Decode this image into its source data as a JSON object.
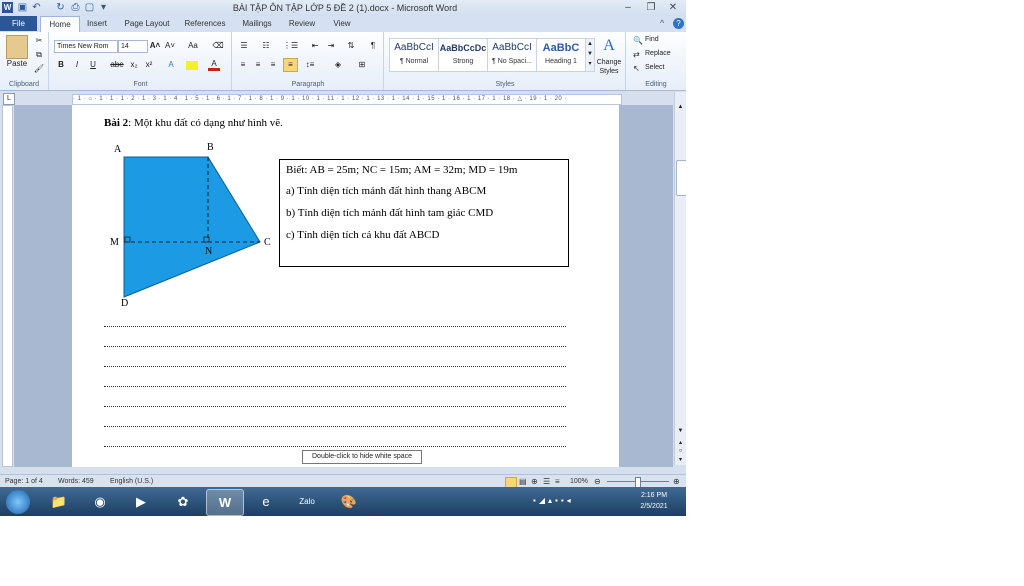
{
  "window": {
    "title": "BÀI TẬP ÔN TẬP LỚP 5 ĐỀ 2 (1).docx - Microsoft Word",
    "minimize_icon": "minimize-icon",
    "restore_icon": "restore-icon",
    "close_icon": "close-icon"
  },
  "tabs": [
    {
      "label": "File"
    },
    {
      "label": "Home"
    },
    {
      "label": "Insert"
    },
    {
      "label": "Page Layout"
    },
    {
      "label": "References"
    },
    {
      "label": "Mailings"
    },
    {
      "label": "Review"
    },
    {
      "label": "View"
    }
  ],
  "ribbon": {
    "clipboard": {
      "paste_label": "Paste",
      "group_label": "Clipboard"
    },
    "font": {
      "font_name": "Times New Rom",
      "font_size": "14",
      "group_label": "Font",
      "bold": "B",
      "italic": "I",
      "underline": "U",
      "strike": "abe",
      "sub": "x₂",
      "sup": "x²"
    },
    "paragraph": {
      "group_label": "Paragraph"
    },
    "styles": {
      "group_label": "Styles",
      "items": [
        {
          "sample": "AaBbCcI",
          "name": "¶ Normal"
        },
        {
          "sample": "AaBbCcDc",
          "name": "Strong"
        },
        {
          "sample": "AaBbCcI",
          "name": "¶ No Spaci..."
        },
        {
          "sample": "AaBbC",
          "name": "Heading 1"
        }
      ],
      "change_label": "Change Styles"
    },
    "editing": {
      "find": "Find",
      "replace": "Replace",
      "select": "Select",
      "group_label": "Editing"
    }
  },
  "document": {
    "problem_label": "Bài 2",
    "problem_text": ": Một khu đất có dạng như hình vẽ.",
    "vertices": {
      "A": "A",
      "B": "B",
      "C": "C",
      "D": "D",
      "M": "M",
      "N": "N"
    },
    "info": {
      "given": "Biết: AB = 25m; NC = 15m; AM = 32m; MD = 19m",
      "a": "a) Tính diện tích mảnh đất hình thang ABCM",
      "b": "b) Tính diện tích mảnh đất hình tam giác CMD",
      "c": "c) Tính diện tích cả khu đất ABCD"
    },
    "tooltip": "Double-click to hide white space"
  },
  "ruler": {
    "text": "· 1 · ⌂ · 1 · 1 · 1 · 2 · 1 · 3 · 1 · 4 · 1 · 5 · 1 · 6 · 1 · 7 · 1 · 8 · 1 · 9 · 1 · 10 · 1 · 11 · 1 · 12 · 1 · 13 · 1 · 14 · 1 · 15 · 1 · 16 · 1 · 17 · 1 · 18 · △ · 19 · 1 · 20 ·"
  },
  "status": {
    "page": "Page: 1 of 4",
    "words": "Words: 459",
    "language": "English (U.S.)",
    "zoom": "100%"
  },
  "clock": {
    "time": "2:16 PM",
    "date": "2/5/2021"
  },
  "colors": {
    "shape_fill": "#1c9be4",
    "file_tab": "#2b5797"
  }
}
